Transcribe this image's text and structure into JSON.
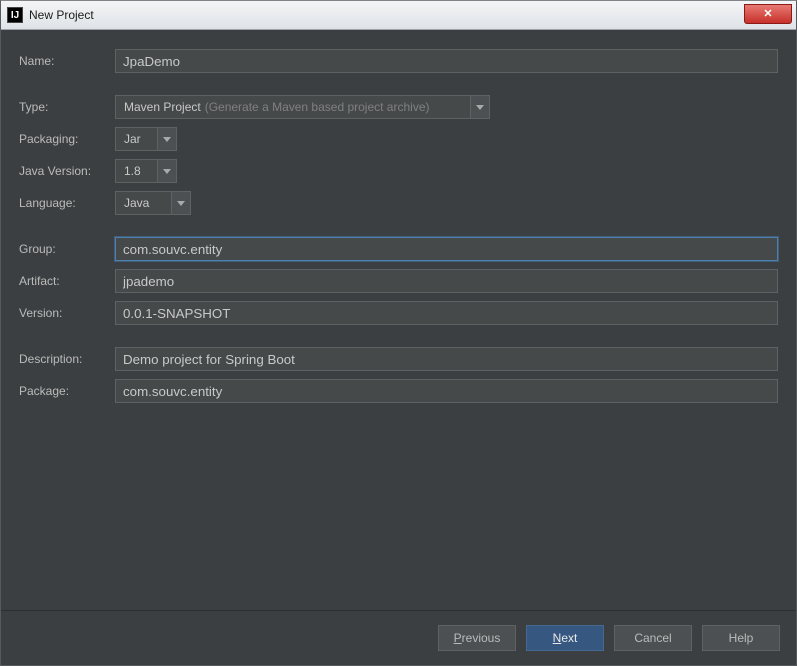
{
  "window": {
    "title": "New Project"
  },
  "form": {
    "name": {
      "label": "Name:",
      "value": "JpaDemo"
    },
    "type": {
      "label": "Type:",
      "value": "Maven Project",
      "hint": "(Generate a Maven based project archive)"
    },
    "packaging": {
      "label": "Packaging:",
      "value": "Jar"
    },
    "javaVersion": {
      "label": "Java Version:",
      "value": "1.8"
    },
    "language": {
      "label": "Language:",
      "value": "Java"
    },
    "group": {
      "label": "Group:",
      "value": "com.souvc.entity"
    },
    "artifact": {
      "label": "Artifact:",
      "value": "jpademo"
    },
    "version": {
      "label": "Version:",
      "value": "0.0.1-SNAPSHOT"
    },
    "description": {
      "label": "Description:",
      "value": "Demo project for Spring Boot"
    },
    "package": {
      "label": "Package:",
      "value": "com.souvc.entity"
    }
  },
  "buttons": {
    "previous": "Previous",
    "next": "Next",
    "cancel": "Cancel",
    "help": "Help"
  }
}
